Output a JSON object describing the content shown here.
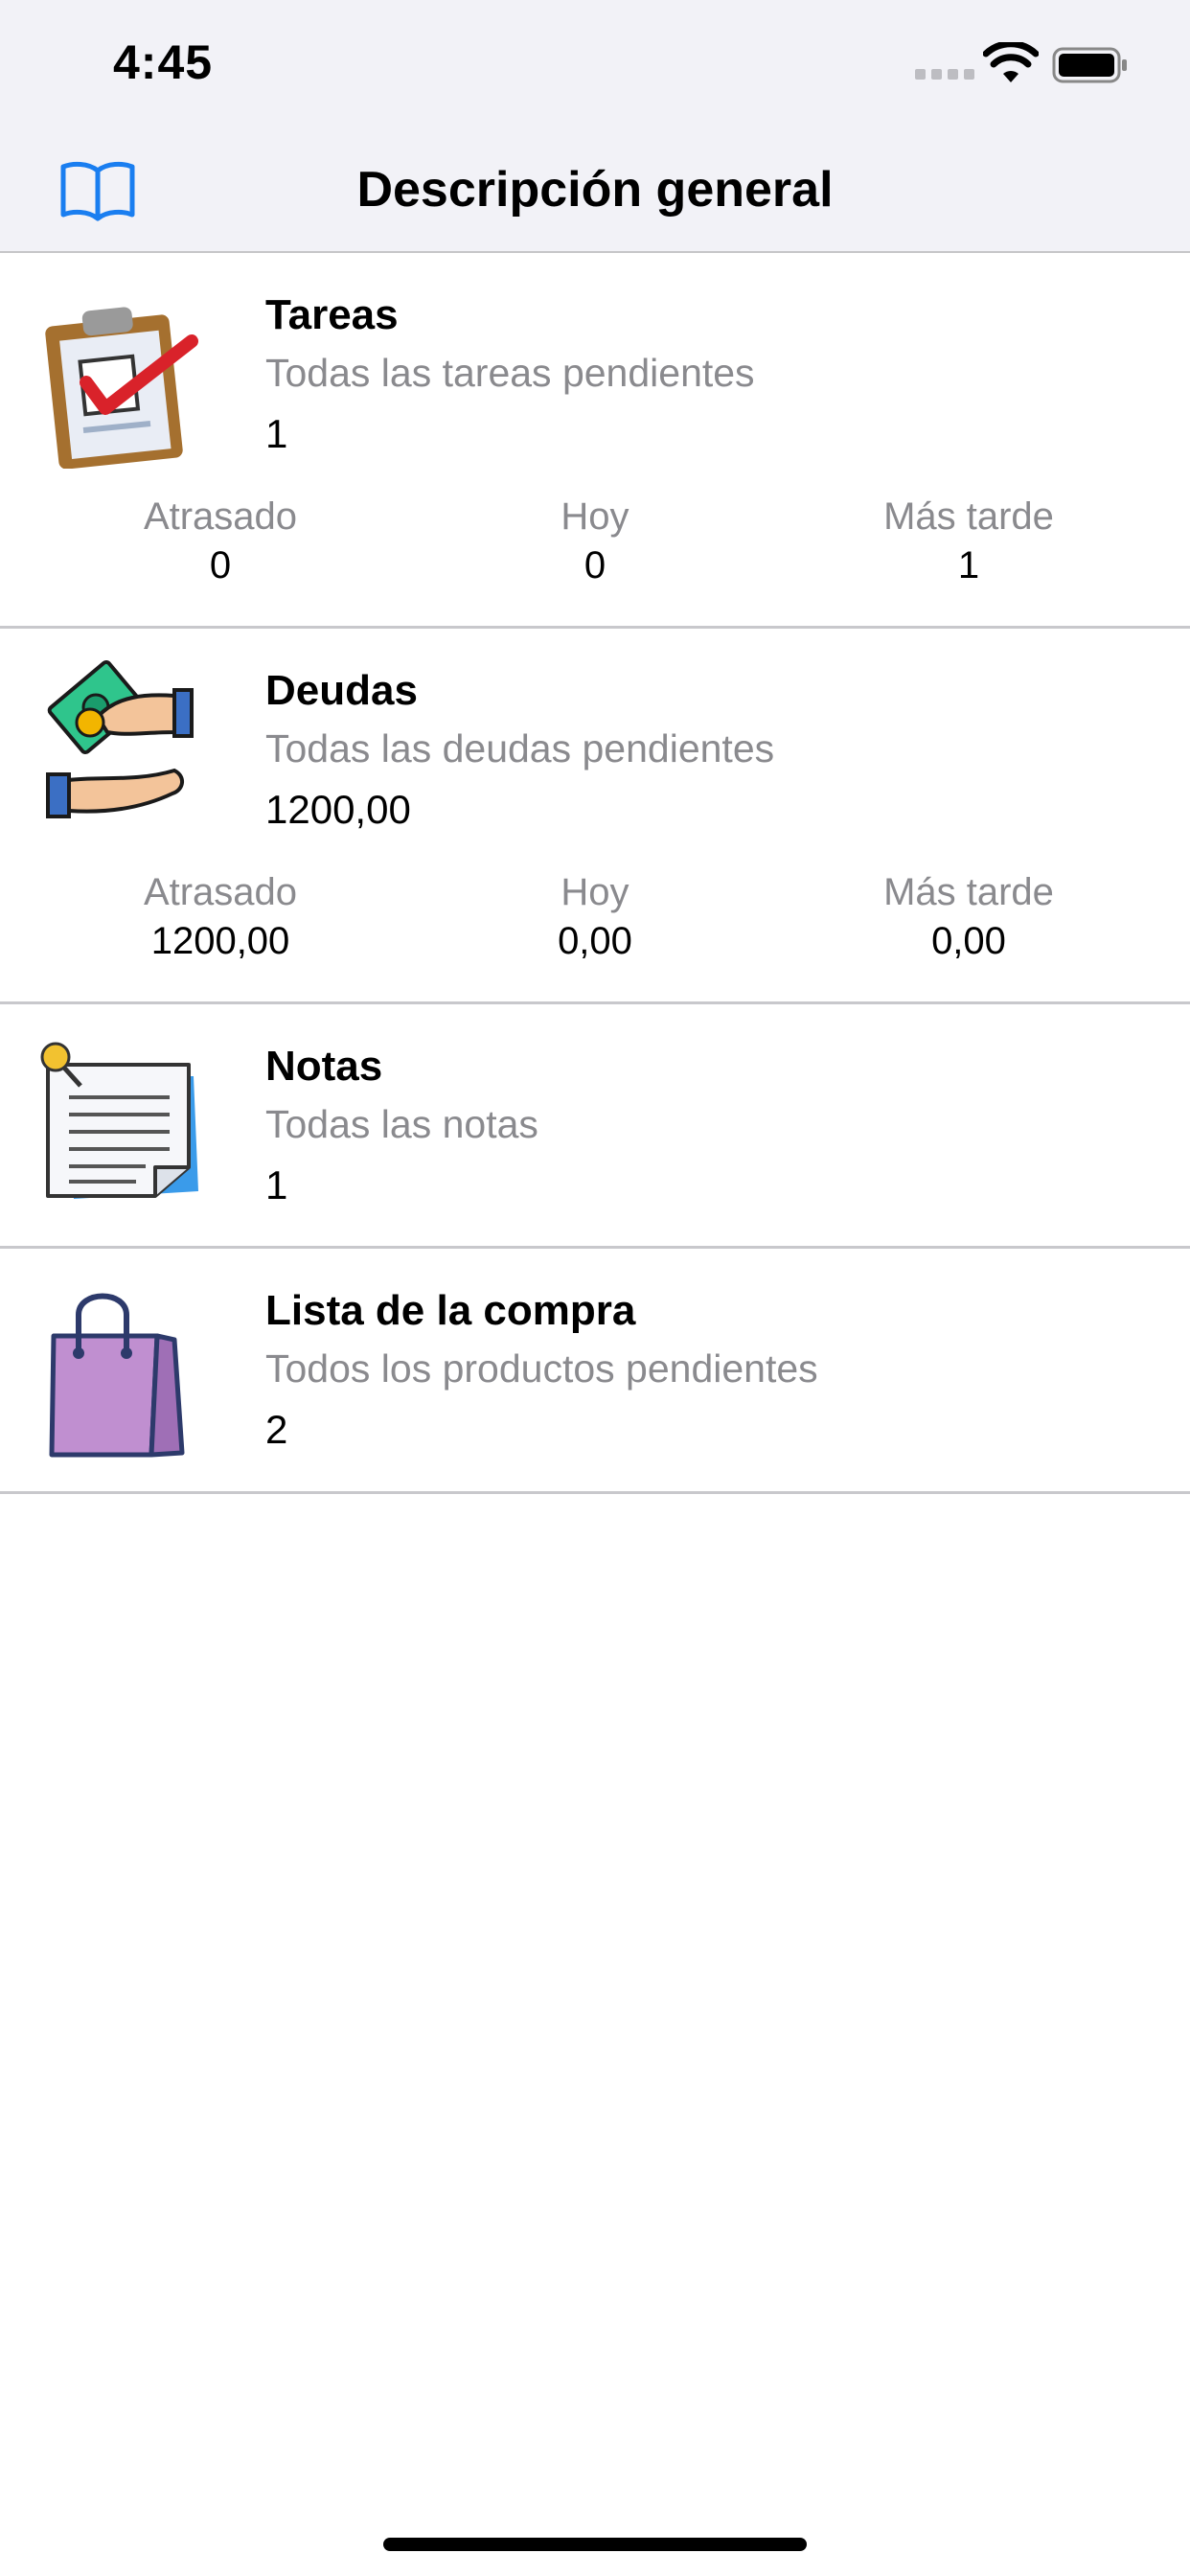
{
  "status_bar": {
    "time": "4:45"
  },
  "nav": {
    "title": "Descripción general",
    "left_icon": "book-icon"
  },
  "cards": [
    {
      "icon": "clipboard-check-icon",
      "title": "Tareas",
      "subtitle": "Todas las tareas pendientes",
      "count": "1",
      "stats": [
        {
          "label": "Atrasado",
          "value": "0"
        },
        {
          "label": "Hoy",
          "value": "0"
        },
        {
          "label": "Más tarde",
          "value": "1"
        }
      ]
    },
    {
      "icon": "money-hands-icon",
      "title": "Deudas",
      "subtitle": "Todas las deudas pendientes",
      "count": "1200,00",
      "stats": [
        {
          "label": "Atrasado",
          "value": "1200,00"
        },
        {
          "label": "Hoy",
          "value": "0,00"
        },
        {
          "label": "Más tarde",
          "value": "0,00"
        }
      ]
    },
    {
      "icon": "note-pin-icon",
      "title": "Notas",
      "subtitle": "Todas las notas",
      "count": "1"
    },
    {
      "icon": "shopping-bag-icon",
      "title": "Lista de la compra",
      "subtitle": "Todos los productos pendientes",
      "count": "2"
    }
  ],
  "colors": {
    "accent": "#1a7ef0",
    "secondary_text": "#8a8a8e",
    "background_bar": "#f2f2f7"
  }
}
